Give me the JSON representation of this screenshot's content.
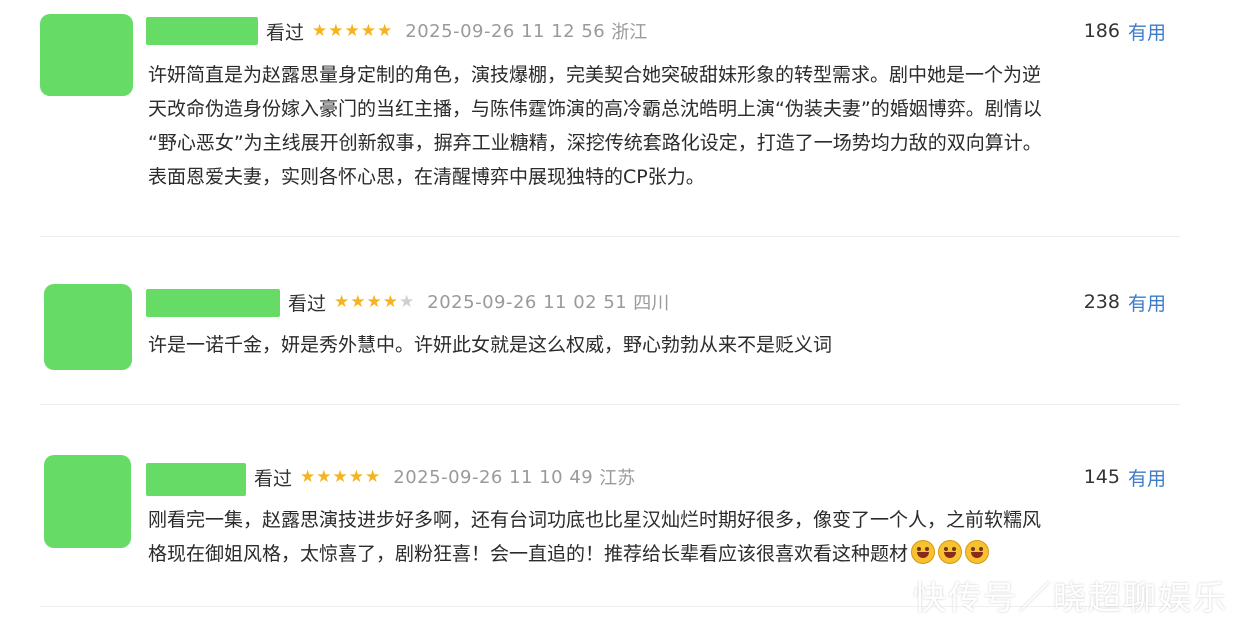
{
  "reviews": [
    {
      "status": "看过",
      "rating": 5,
      "time": "2025-09-26 11 12 56",
      "location": "浙江",
      "useful_count": "186",
      "useful_label": "有用",
      "lines": [
        "许妍简直是为赵露思量身定制的角色，演技爆棚，完美契合她突破甜妹形象的转型需求。剧中她是一个为逆",
        "天改命伪造身份嫁入豪门的当红主播，与陈伟霆饰演的高冷霸总沈皓明上演“伪装夫妻”的婚姻博弈。剧情以",
        "“野心恶女”为主线展开创新叙事，摒弃工业糖精，深挖传统套路化设定，打造了一场势均力敌的双向算计。",
        "表面恩爱夫妻，实则各怀心思，在清醒博弈中展现独特的CP张力。"
      ]
    },
    {
      "status": "看过",
      "rating": 4,
      "time": "2025-09-26 11 02 51",
      "location": "四川",
      "useful_count": "238",
      "useful_label": "有用",
      "lines": [
        "许是一诺千金，妍是秀外慧中。许妍此女就是这么权威，野心勃勃从来不是贬义词"
      ]
    },
    {
      "status": "看过",
      "rating": 5,
      "time": "2025-09-26 11 10 49",
      "location": "江苏",
      "useful_count": "145",
      "useful_label": "有用",
      "lines": [
        "刚看完一集，赵露思演技进步好多啊，还有台词功底也比星汉灿烂时期好很多，像变了一个人，之前软糯风",
        "格现在御姐风格，太惊喜了，剧粉狂喜！会一直追的！推荐给长辈看应该很喜欢看这种题材"
      ],
      "emojis": [
        "grin-emoji",
        "grin-emoji",
        "grin-emoji"
      ]
    }
  ],
  "watermark": "快传号／晓超聊娱乐",
  "colors": {
    "placeholder_green": "#66dc66",
    "star_gold": "#f5b41e",
    "link_blue": "#3d7cc9"
  }
}
